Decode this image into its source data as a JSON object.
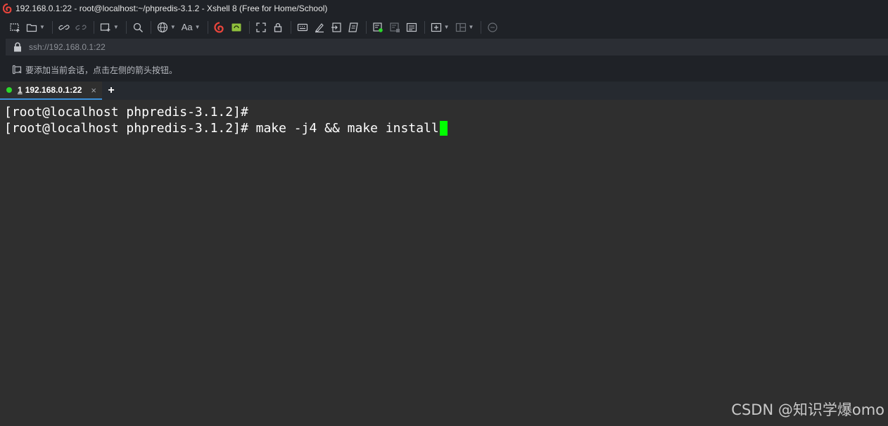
{
  "window": {
    "title": "192.168.0.1:22 - root@localhost:~/phpredis-3.1.2 - Xshell 8 (Free for Home/School)",
    "app_icon": "xshell-logo-icon"
  },
  "toolbar": {
    "buttons": [
      "new-session-icon",
      "open-session-icon",
      "reconnect-icon",
      "disconnect-icon",
      "new-tab-icon",
      "find-icon",
      "encoding-icon",
      "font-icon",
      "xshell-icon",
      "xftp-icon",
      "fullscreen-icon",
      "lock-icon",
      "keyboard-icon",
      "highlight-icon",
      "transfer-icon",
      "script-icon",
      "log-green-icon",
      "log-gray-icon",
      "log-compose-icon",
      "tab-add-icon",
      "layout-icon",
      "chat-icon"
    ]
  },
  "address": {
    "value": "ssh://192.168.0.1:22",
    "icon": "lock-icon"
  },
  "hint": {
    "text": "要添加当前会话，点击左侧的箭头按钮。",
    "icon": "add-session-icon"
  },
  "tabs": [
    {
      "number": "1",
      "label": "192.168.0.1:22",
      "status_color": "#2bd92b",
      "active": true
    }
  ],
  "tab_add_label": "+",
  "tab_close_label": "×",
  "terminal": {
    "lines": [
      "[root@localhost phpredis-3.1.2]#",
      "[root@localhost phpredis-3.1.2]# make -j4 && make install"
    ],
    "cursor_color": "#00ff00"
  },
  "watermark": "CSDN @知识学爆omo",
  "colors": {
    "chrome_bg": "#1f2227",
    "terminal_bg": "#2f2f2f",
    "terminal_fg": "#ffffff",
    "accent": "#3a8fd9"
  }
}
